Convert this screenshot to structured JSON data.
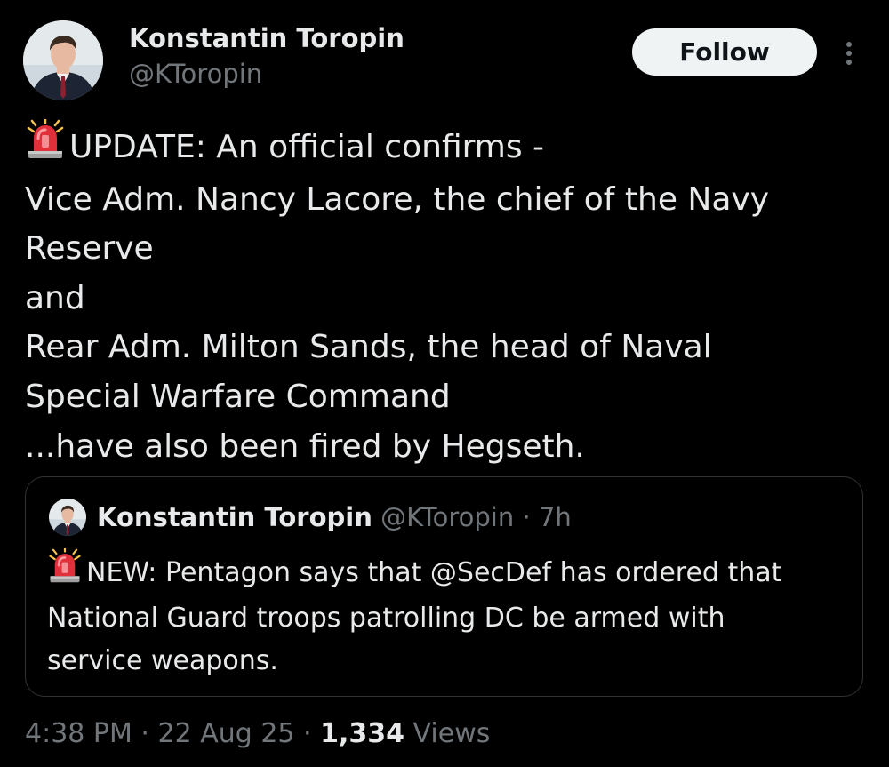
{
  "author": {
    "display_name": "Konstantin Toropin",
    "handle": "@KToropin"
  },
  "actions": {
    "follow_label": "Follow",
    "more_icon": "more-vertical-icon"
  },
  "tweet": {
    "emoji_icon": "police-siren-icon",
    "lines": [
      "UPDATE: An official confirms -",
      "Vice Adm. Nancy Lacore, the chief of the Navy",
      "Reserve",
      "and",
      "Rear Adm. Milton Sands, the head of Naval",
      "Special Warfare Command",
      "...have also been fired by Hegseth."
    ]
  },
  "quoted_tweet": {
    "display_name": "Konstantin Toropin",
    "handle": "@KToropin",
    "separator": " · ",
    "time": "7h",
    "emoji_icon": "police-siren-icon",
    "lines": [
      "NEW: Pentagon says that @SecDef has ordered that",
      "National Guard troops patrolling DC be armed with",
      "service weapons."
    ]
  },
  "meta": {
    "time": "4:38 PM",
    "separator": " · ",
    "date": "22 Aug 25",
    "views_count": "1,334",
    "views_label": " Views"
  },
  "colors": {
    "background": "#000000",
    "primary_text": "#e7e9ea",
    "secondary_text": "#71767b",
    "border": "#2f3336",
    "follow_bg": "#eff3f4"
  }
}
